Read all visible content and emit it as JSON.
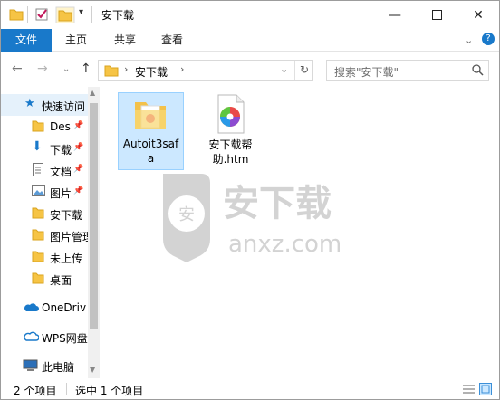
{
  "window": {
    "title": "安下载"
  },
  "ribbon": {
    "tabs": [
      "文件",
      "主页",
      "共享",
      "查看"
    ]
  },
  "address": {
    "path": "安下载",
    "search_placeholder": "搜索\"安下载\""
  },
  "sidebar": {
    "items": [
      {
        "label": "快速访问",
        "icon": "star-icon"
      },
      {
        "label": "Des",
        "icon": "folder-icon",
        "pinned": true
      },
      {
        "label": "下载",
        "icon": "download-icon",
        "pinned": true
      },
      {
        "label": "文档",
        "icon": "document-icon",
        "pinned": true
      },
      {
        "label": "图片",
        "icon": "picture-icon",
        "pinned": true
      },
      {
        "label": "安下载",
        "icon": "folder-icon"
      },
      {
        "label": "图片管理",
        "icon": "folder-icon"
      },
      {
        "label": "未上传",
        "icon": "folder-icon"
      },
      {
        "label": "桌面",
        "icon": "folder-icon"
      },
      {
        "label": "OneDriv",
        "icon": "cloud-icon"
      },
      {
        "label": "WPS网盘",
        "icon": "cloud-icon"
      },
      {
        "label": "此电脑",
        "icon": "computer-icon"
      }
    ]
  },
  "files": [
    {
      "name": "Autoit3safa",
      "type": "folder",
      "selected": true
    },
    {
      "name": "安下载帮助.htm",
      "type": "htm"
    }
  ],
  "watermark": {
    "brand": "安下载",
    "domain": "anxz.com"
  },
  "status": {
    "count": "2 个项目",
    "selected": "选中 1 个项目"
  }
}
